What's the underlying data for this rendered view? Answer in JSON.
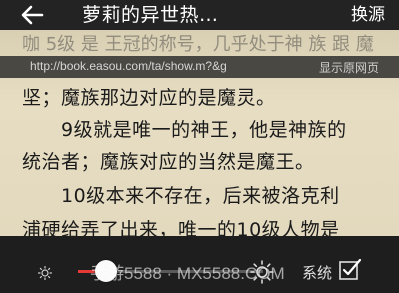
{
  "header": {
    "title": "萝莉的异世热…",
    "source_label": "换源"
  },
  "reader": {
    "faded_line": "咖 5级 是 王冠的称号，几乎处于神 族 跟 魔",
    "url": "http://book.easou.com/ta/show.m?&g",
    "show_web_label": "显示原网页",
    "lines": [
      "坚；魔族那边对应的是魔灵。",
      "　　9级就是唯一的神王，他是神族的",
      "统治者；魔族对应的当然是魔王。",
      "　　10级本来不存在，后来被洛克利",
      "浦硬给弄了出来，唯一的10级人物是"
    ]
  },
  "bottom": {
    "watermark": "手游5588 · MX5588.COM",
    "brightness_value": 0.15,
    "system_label": "系统",
    "system_checked": true
  },
  "colors": {
    "accent": "#e53935",
    "paper": "#e4dbc1",
    "bar": "#1e1e1e"
  }
}
